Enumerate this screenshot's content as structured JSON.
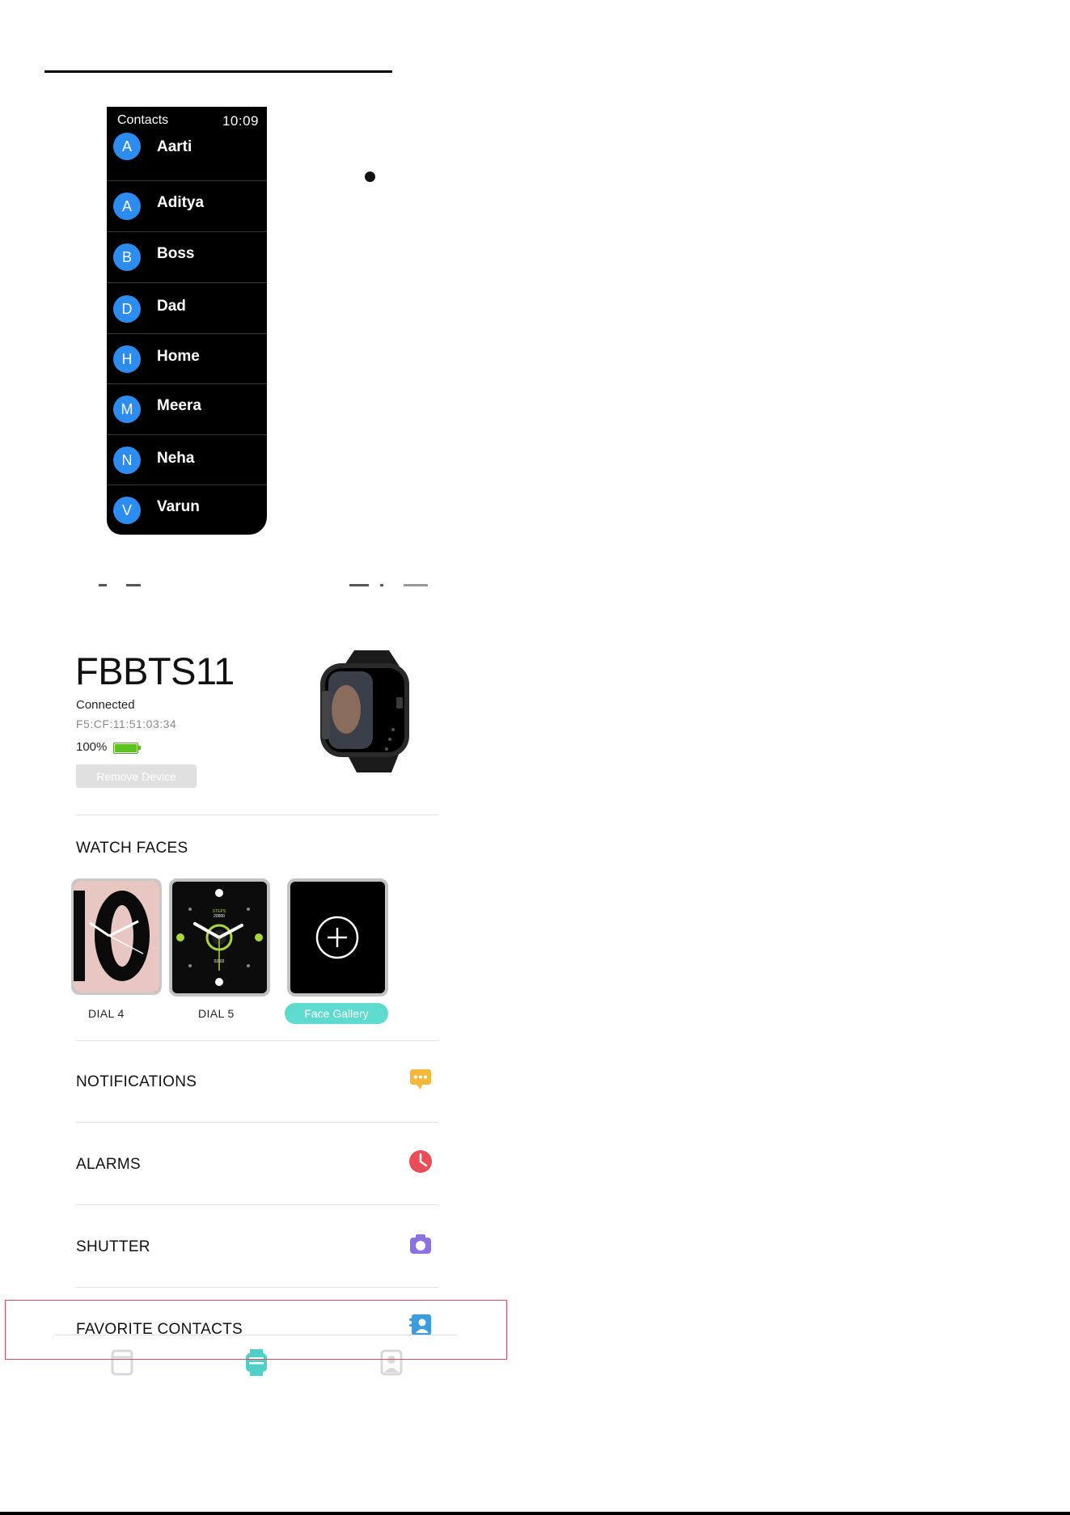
{
  "watch_screen": {
    "title": "Contacts",
    "time": "10:09",
    "contacts": [
      {
        "initial": "A",
        "name": "Aarti"
      },
      {
        "initial": "A",
        "name": "Aditya"
      },
      {
        "initial": "B",
        "name": "Boss"
      },
      {
        "initial": "D",
        "name": "Dad"
      },
      {
        "initial": "H",
        "name": "Home"
      },
      {
        "initial": "M",
        "name": "Meera"
      },
      {
        "initial": "N",
        "name": "Neha"
      },
      {
        "initial": "V",
        "name": "Varun"
      }
    ]
  },
  "device": {
    "name": "FBBTS11",
    "status": "Connected",
    "mac": "F5:CF:11:51:03:34",
    "battery_label": "100%",
    "battery_level": 1.0,
    "remove_label": "Remove Device"
  },
  "watch_faces": {
    "title": "WATCH FACES",
    "faces": [
      {
        "label": "DIAL 4"
      },
      {
        "label": "DIAL 5"
      },
      {
        "label": "Face Gallery"
      }
    ]
  },
  "menu": [
    {
      "label": "NOTIFICATIONS",
      "icon": "message-icon",
      "color": "#f5b83a"
    },
    {
      "label": "ALARMS",
      "icon": "clock-icon",
      "color": "#ea4d57"
    },
    {
      "label": "SHUTTER",
      "icon": "camera-icon",
      "color": "#8c72e0"
    },
    {
      "label": "FAVORITE CONTACTS",
      "icon": "contacts-book-icon",
      "color": "#3a9de0"
    }
  ],
  "tabbar": {
    "tabs": [
      {
        "icon": "home-tab-icon",
        "active": false
      },
      {
        "icon": "watch-tab-icon",
        "active": true
      },
      {
        "icon": "profile-tab-icon",
        "active": false
      }
    ],
    "active_color": "#4fcfc5",
    "inactive_color": "#d8d8d8"
  },
  "highlight_color": "#d94a5a"
}
